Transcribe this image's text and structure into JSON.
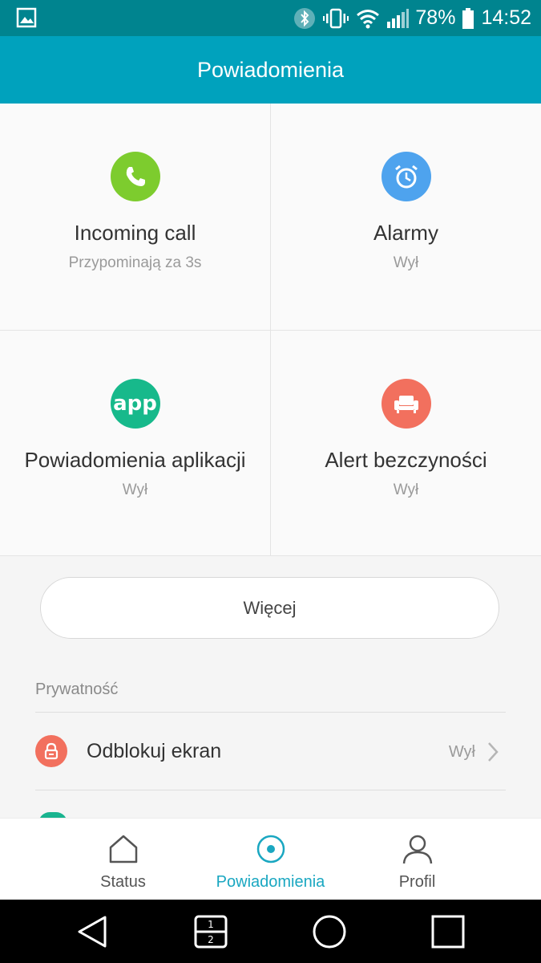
{
  "statusbar": {
    "battery_percent": "78%",
    "time": "14:52",
    "icons": [
      "image-icon",
      "bluetooth-icon",
      "vibrate-icon",
      "wifi-icon",
      "signal-icon",
      "battery-icon"
    ]
  },
  "header": {
    "title": "Powiadomienia"
  },
  "tiles": [
    {
      "title": "Incoming call",
      "subtitle": "Przypominają za 3s",
      "icon": "phone-icon",
      "color": "#7dcc2e"
    },
    {
      "title": "Alarmy",
      "subtitle": "Wył",
      "icon": "alarm-clock-icon",
      "color": "#4ea3ee"
    },
    {
      "title": "Powiadomienia aplikacji",
      "subtitle": "Wył",
      "icon": "app-icon",
      "icon_text": "app",
      "color": "#17b98b"
    },
    {
      "title": "Alert bezczyności",
      "subtitle": "Wył",
      "icon": "sofa-icon",
      "color": "#f2705e"
    }
  ],
  "more_button": {
    "label": "Więcej"
  },
  "privacy": {
    "section_label": "Prywatność",
    "items": [
      {
        "label": "Odblokuj ekran",
        "value": "Wył",
        "icon": "lock-icon",
        "color": "#f2705e"
      }
    ]
  },
  "bottom_nav": {
    "items": [
      {
        "label": "Status",
        "icon": "home-icon",
        "active": false
      },
      {
        "label": "Powiadomienia",
        "icon": "notification-dot-icon",
        "active": true
      },
      {
        "label": "Profil",
        "icon": "person-icon",
        "active": false
      }
    ],
    "active_color": "#1aa7c1"
  },
  "system_nav": {
    "icons": [
      "back-icon",
      "dual-window-icon",
      "home-circle-icon",
      "recents-icon"
    ]
  }
}
